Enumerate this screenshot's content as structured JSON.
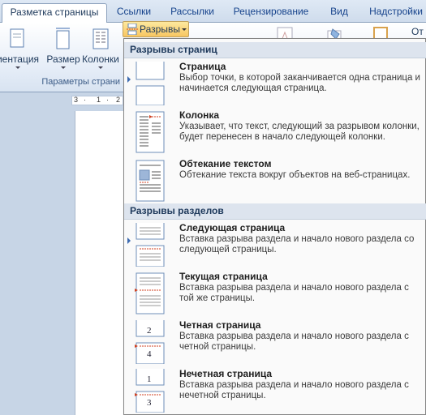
{
  "tabs": [
    {
      "label": "Разметка страницы",
      "active": true
    },
    {
      "label": "Ссылки",
      "active": false
    },
    {
      "label": "Рассылки",
      "active": false
    },
    {
      "label": "Рецензирование",
      "active": false
    },
    {
      "label": "Вид",
      "active": false
    },
    {
      "label": "Надстройки",
      "active": false
    }
  ],
  "ribbon": {
    "orientation_label": "иентация",
    "size_label": "Размер",
    "columns_label": "Колонки",
    "group_label": "Параметры страни",
    "breaks_label": "Разрывы",
    "cut_label": "От"
  },
  "ruler": {
    "ticks": [
      "3",
      "·",
      "1",
      "·",
      "2"
    ]
  },
  "menu": {
    "page_breaks_header": "Разрывы страниц",
    "section_breaks_header": "Разрывы разделов",
    "page_breaks": [
      {
        "title": "Страница",
        "description": "Выбор точки, в которой заканчивается одна страница и начинается следующая страница.",
        "icon": "page-break-icon"
      },
      {
        "title": "Колонка",
        "description": "Указывает, что текст, следующий за разрывом колонки, будет перенесен в начало следующей колонки.",
        "icon": "column-break-icon"
      },
      {
        "title": "Обтекание текстом",
        "description": "Обтекание текста вокруг объектов на веб-страницах.",
        "icon": "text-wrapping-icon"
      }
    ],
    "section_breaks": [
      {
        "title": "Следующая страница",
        "description": "Вставка разрыва раздела и начало нового раздела со следующей страницы.",
        "icon": "next-page-icon"
      },
      {
        "title": "Текущая страница",
        "description": "Вставка разрыва раздела и начало нового раздела с той же страницы.",
        "icon": "continuous-icon"
      },
      {
        "title": "Четная страница",
        "description": "Вставка разрыва раздела и начало нового раздела с четной страницы.",
        "icon": "even-page-icon",
        "numbers": [
          "2",
          "4"
        ]
      },
      {
        "title": "Нечетная страница",
        "description": "Вставка разрыва раздела и начало нового раздела с нечетной страницы.",
        "icon": "odd-page-icon",
        "numbers": [
          "1",
          "3"
        ]
      }
    ]
  }
}
